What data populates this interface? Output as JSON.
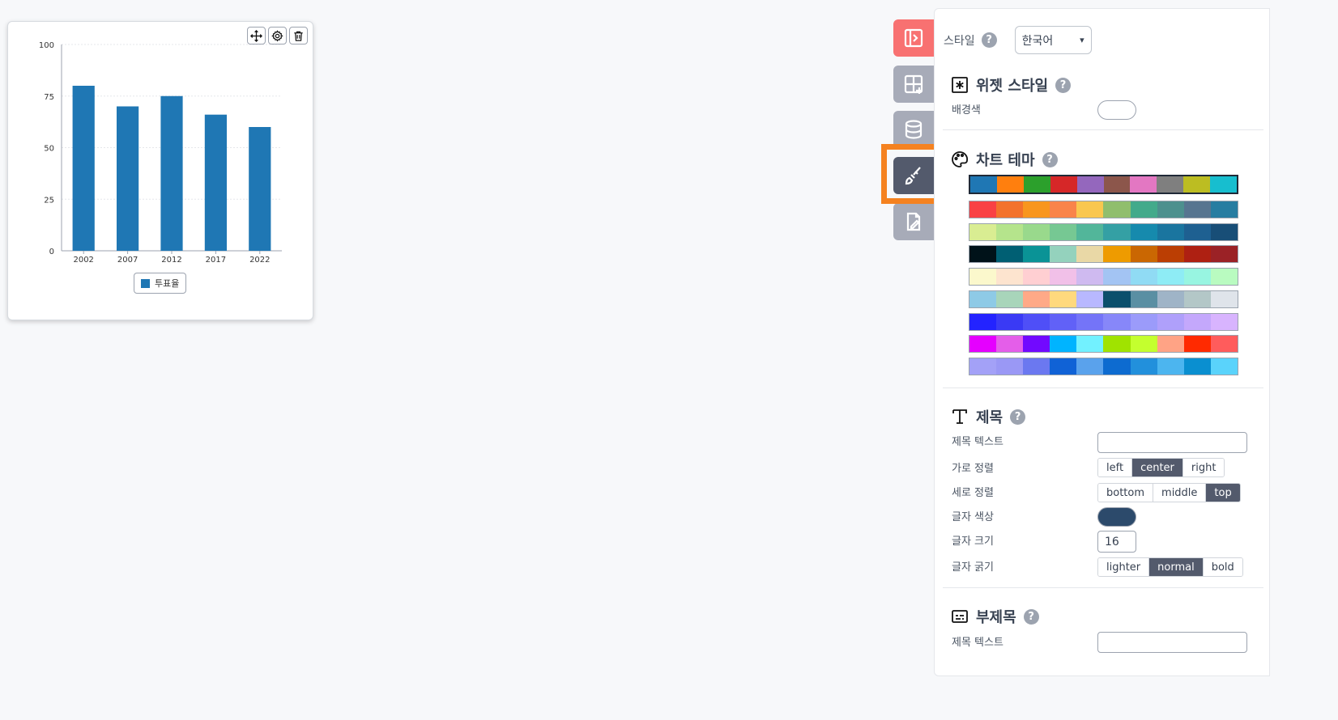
{
  "chart_data": {
    "type": "bar",
    "categories": [
      "2002",
      "2007",
      "2012",
      "2017",
      "2022"
    ],
    "series": [
      {
        "name": "투표율",
        "values": [
          80,
          70,
          75,
          66,
          60
        ],
        "color": "#1f77b4"
      }
    ],
    "yticks": [
      "0",
      "25",
      "50",
      "75",
      "100"
    ],
    "ylim": [
      0,
      100
    ],
    "grid": true,
    "legend_position": "bottom"
  },
  "widget": {
    "tools": [
      {
        "name": "move-icon"
      },
      {
        "name": "gear-icon"
      },
      {
        "name": "trash-icon"
      }
    ]
  },
  "sidenav": {
    "items": [
      {
        "name": "panel-toggle-icon",
        "color": "#f87171"
      },
      {
        "name": "add-widget-icon",
        "color": "#a7abb8"
      },
      {
        "name": "database-icon",
        "color": "#a7abb8"
      },
      {
        "name": "brush-icon",
        "color": "#535a6c",
        "active": true
      },
      {
        "name": "edit-document-icon",
        "color": "#a7abb8"
      }
    ],
    "highlight_color": "#f58220"
  },
  "panel": {
    "style_label": "스타일",
    "language": "한국어",
    "widget_style": {
      "title": "위젯 스타일",
      "bg_label": "배경색",
      "bg_color": "#ffffff"
    },
    "chart_theme": {
      "title": "차트 테마",
      "palettes": [
        [
          "#1f77b4",
          "#ff7f0e",
          "#2ca02c",
          "#d62728",
          "#9467bd",
          "#8c564b",
          "#e377c2",
          "#7f7f7f",
          "#bcbd22",
          "#17becf"
        ],
        [
          "#f94144",
          "#f3722c",
          "#f8961e",
          "#f9844a",
          "#f9c74f",
          "#90be6d",
          "#43aa8b",
          "#4d908e",
          "#577590",
          "#277da1"
        ],
        [
          "#d9ed92",
          "#b5e48c",
          "#99d98c",
          "#76c893",
          "#52b69a",
          "#34a0a4",
          "#168aad",
          "#1a759f",
          "#1e6091",
          "#184e77"
        ],
        [
          "#001219",
          "#005f73",
          "#0a9396",
          "#94d2bd",
          "#e9d8a6",
          "#ee9b00",
          "#ca6702",
          "#bb3e03",
          "#ae2012",
          "#9b2226"
        ],
        [
          "#fbf8cc",
          "#fde4cf",
          "#ffcfd2",
          "#f1c0e8",
          "#cfbaf0",
          "#a3c4f3",
          "#90dbf4",
          "#8eecf5",
          "#98f5e1",
          "#b9fbc0"
        ],
        [
          "#8ecae6",
          "#a8d5ba",
          "#ffa987",
          "#ffd97d",
          "#b8b8ff",
          "#0b4f6c",
          "#5a8fa3",
          "#9fb4c7",
          "#b3c7c7",
          "#dfe4ea"
        ],
        [
          "#2323ff",
          "#3a3af5",
          "#4f4ff7",
          "#6161f7",
          "#7474f8",
          "#8787f9",
          "#9b9bfa",
          "#afa0fb",
          "#c4a8fc",
          "#d8b4fe"
        ],
        [
          "#e500ff",
          "#e45ee9",
          "#7209ff",
          "#00b4ff",
          "#72f1ff",
          "#a0e300",
          "#c4ff2e",
          "#ffa385",
          "#ff2a00",
          "#ff5c5c"
        ],
        [
          "#a3a1f7",
          "#9a98f5",
          "#6b78f0",
          "#1062d6",
          "#5aa2ec",
          "#0d6bd0",
          "#2290dc",
          "#4cb5ef",
          "#0a8fd0",
          "#5ad3fb"
        ]
      ],
      "selected": 0
    },
    "title_section": {
      "title": "제목",
      "text_label": "제목 텍스트",
      "h_align_label": "가로 정렬",
      "h_align_options": [
        "left",
        "center",
        "right"
      ],
      "h_align_selected": "center",
      "v_align_label": "세로 정렬",
      "v_align_options": [
        "bottom",
        "middle",
        "top"
      ],
      "v_align_selected": "top",
      "color_label": "글자 색상",
      "color": "#2c4a6b",
      "size_label": "글자 크기",
      "size": "16",
      "weight_label": "글자 굵기",
      "weight_options": [
        "lighter",
        "normal",
        "bold"
      ],
      "weight_selected": "normal"
    },
    "subtitle_section": {
      "title": "부제목",
      "text_label": "제목 텍스트"
    }
  }
}
